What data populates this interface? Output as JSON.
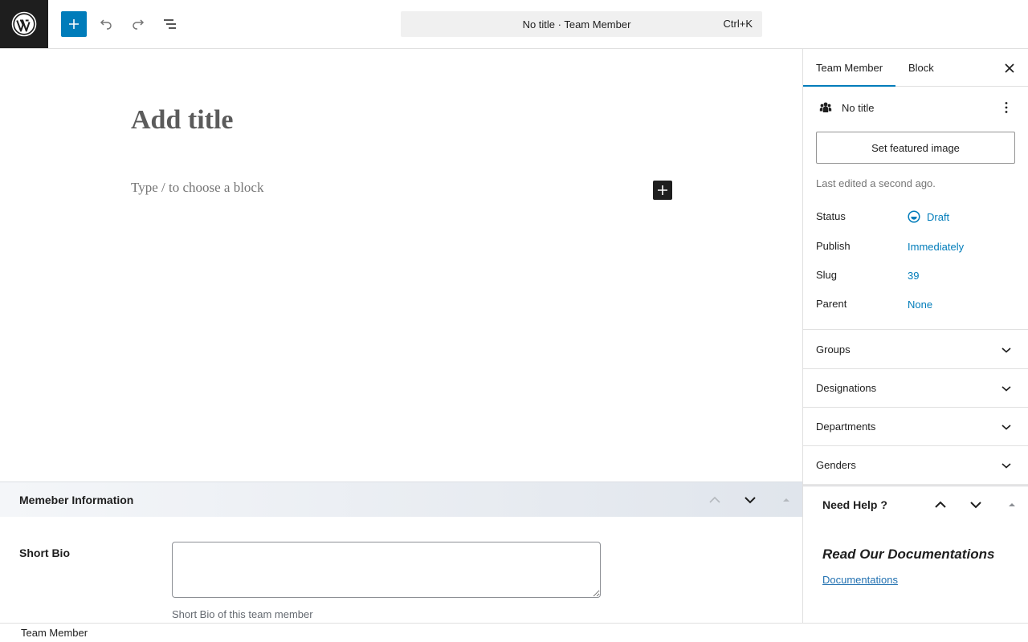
{
  "topbar": {
    "logo_icon": "wordpress-icon",
    "add_icon": "plus-icon",
    "undo_icon": "undo-icon",
    "redo_icon": "redo-icon",
    "outline_icon": "document-overview-icon",
    "command_title": "No title · Team Member",
    "command_shortcut": "Ctrl+K"
  },
  "editor": {
    "title_placeholder": "Add title",
    "block_placeholder": "Type / to choose a block",
    "inserter_icon": "plus-icon"
  },
  "metabox": {
    "title": "Memeber Information",
    "field_label": "Short Bio",
    "field_value": "",
    "field_description": "Short Bio of this team member"
  },
  "sidebar": {
    "tabs": [
      {
        "label": "Team Member",
        "active": true
      },
      {
        "label": "Block",
        "active": false
      }
    ],
    "close_icon": "close-icon",
    "post": {
      "icon": "groups-icon",
      "title": "No title",
      "featured_button": "Set featured image",
      "last_edited": "Last edited a second ago.",
      "rows": [
        {
          "label": "Status",
          "value": "Draft"
        },
        {
          "label": "Publish",
          "value": "Immediately"
        },
        {
          "label": "Slug",
          "value": "39"
        },
        {
          "label": "Parent",
          "value": "None"
        }
      ]
    },
    "panels": [
      {
        "label": "Groups"
      },
      {
        "label": "Designations"
      },
      {
        "label": "Departments"
      },
      {
        "label": "Genders"
      }
    ],
    "help": {
      "title": "Need Help ?",
      "heading": "Read Our Documentations",
      "link": "Documentations"
    }
  },
  "footer": {
    "breadcrumb": "Team Member"
  },
  "colors": {
    "accent": "#007cba",
    "dark": "#1e1e1e",
    "link": "#2271b1"
  }
}
